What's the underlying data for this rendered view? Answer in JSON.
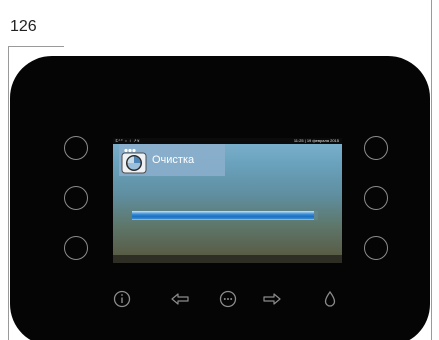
{
  "page": {
    "number": "126"
  },
  "screen": {
    "status_bar": {
      "icons": "①¹⁰ ○ ↕ ↗¥",
      "datetime": "11:25 | 19 февраля 2015"
    },
    "title": "Очистка",
    "title_icon": "cleaning-cycle-icon",
    "progress": 0.98
  },
  "side_buttons": {
    "left": [
      "left-button-1",
      "left-button-2",
      "left-button-3"
    ],
    "right": [
      "right-button-1",
      "right-button-2",
      "right-button-3"
    ]
  },
  "nav_icons": [
    "info-icon",
    "arrow-left-icon",
    "menu-dots-icon",
    "arrow-right-icon",
    "water-drop-icon"
  ],
  "colors": {
    "device_body": "#050505",
    "button_outline": "#8c8c8c",
    "progress_fill": "#1c6fc2",
    "title_box": "#8cafcd"
  }
}
